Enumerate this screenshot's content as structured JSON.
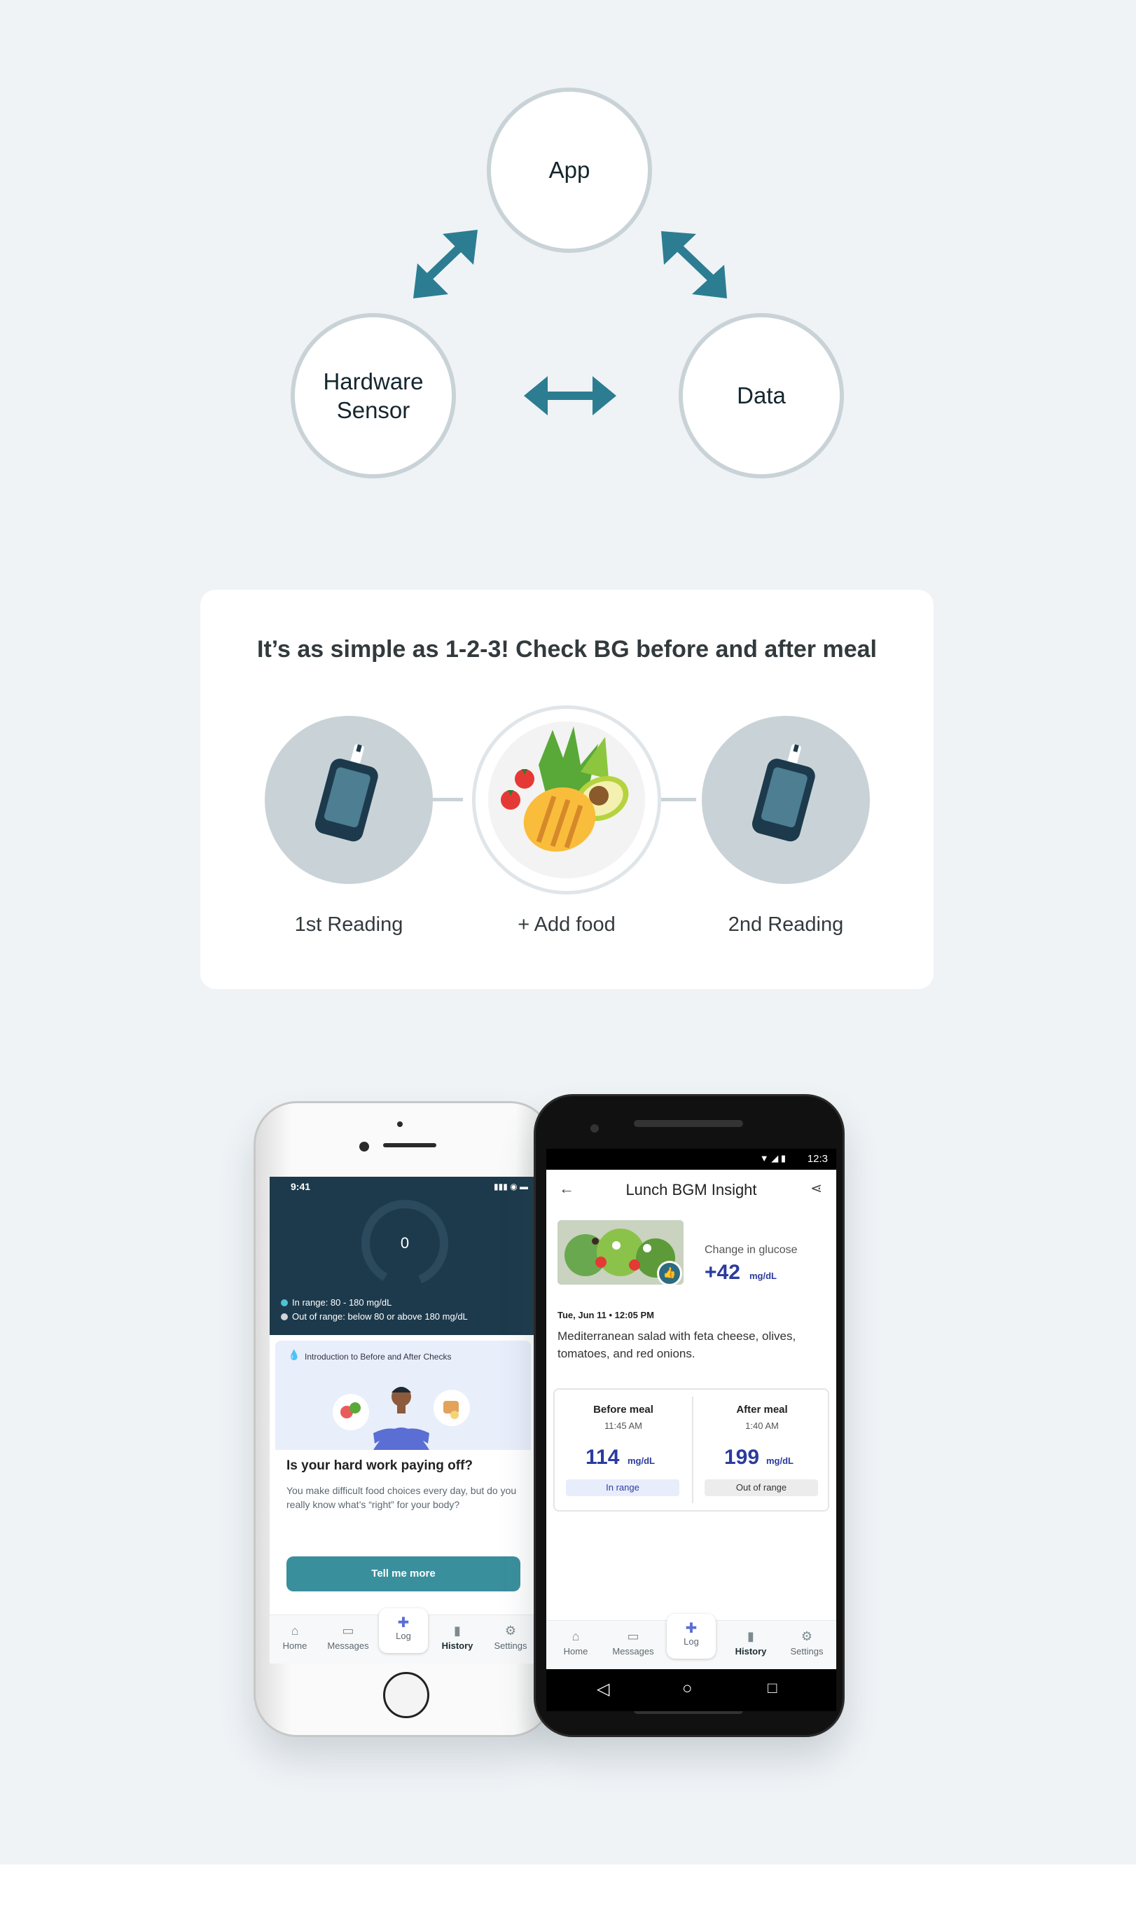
{
  "diagram": {
    "nodes": {
      "app": "App",
      "hardware": "Hardware\nSensor",
      "data": "Data"
    },
    "colors": {
      "arrow": "#2c7d92",
      "node_border": "#c9d3d7"
    }
  },
  "steps": {
    "title": "It’s as simple as 1-2-3! Check BG before and after meal",
    "items": [
      {
        "label": "1st Reading",
        "icon": "glucose-meter-icon"
      },
      {
        "label": "+ Add food",
        "icon": "food-plate-icon"
      },
      {
        "label": "2nd Reading",
        "icon": "glucose-meter-icon"
      }
    ]
  },
  "iphone": {
    "status_time": "9:41",
    "ring_value": "0",
    "legend": [
      {
        "text": "In range: 80 - 180 mg/dL",
        "color": "#4fc3d4"
      },
      {
        "text": "Out of range: below 80 or above 180 mg/dL",
        "color": "#cfd6da"
      }
    ],
    "promo": {
      "intro": "Introduction to Before and After Checks",
      "heading": "Is your hard work paying off?",
      "body": "You make difficult food choices every day, but do you really know what’s “right” for your body?",
      "button": "Tell me more"
    },
    "tabs": [
      {
        "label": "Home",
        "icon": "home-icon"
      },
      {
        "label": "Messages",
        "icon": "messages-icon"
      },
      {
        "label": "Log",
        "icon": "plus-icon"
      },
      {
        "label": "History",
        "icon": "history-icon"
      },
      {
        "label": "Settings",
        "icon": "settings-icon"
      }
    ]
  },
  "android": {
    "status_time": "12:3",
    "title": "Lunch BGM Insight",
    "change_label": "Change in glucose",
    "change_value": "+42",
    "unit": "mg/dL",
    "timestamp": "Tue, Jun 11 • 12:05 PM",
    "meal_desc": "Mediterranean salad with feta cheese, olives, tomatoes, and red onions.",
    "before": {
      "title": "Before meal",
      "time": "11:45 AM",
      "value": "114",
      "status": "In range"
    },
    "after": {
      "title": "After meal",
      "time": "1:40 AM",
      "value": "199",
      "status": "Out of range"
    },
    "tabs": [
      {
        "label": "Home",
        "icon": "home-icon"
      },
      {
        "label": "Messages",
        "icon": "messages-icon"
      },
      {
        "label": "Log",
        "icon": "plus-icon"
      },
      {
        "label": "History",
        "icon": "history-icon"
      },
      {
        "label": "Settings",
        "icon": "settings-icon"
      }
    ]
  }
}
